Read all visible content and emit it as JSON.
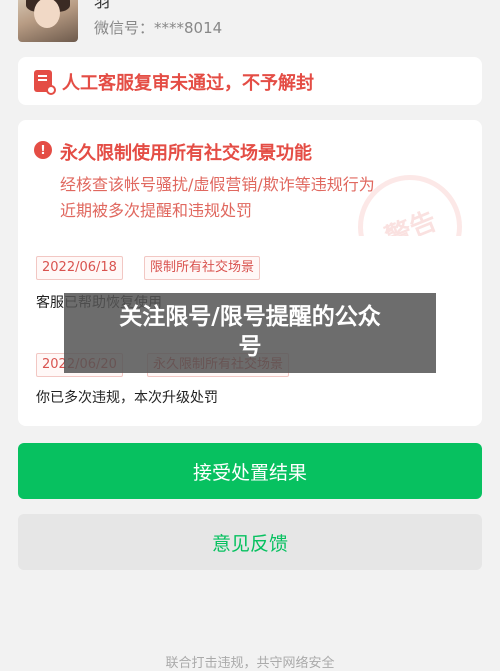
{
  "profile": {
    "nickname": "羽",
    "wechat_id": "微信号：****8014"
  },
  "status": {
    "icon": "no-entry-document-icon",
    "title": "人工客服复审未通过，不予解封"
  },
  "restriction": {
    "icon": "exclamation-circle-icon",
    "title": "永久限制使用所有社交场景功能",
    "desc_line1": "经核查该帐号骚扰/虚假营销/欺诈等违规行为",
    "desc_line2": "近期被多次提醒和违规处罚",
    "seal_text": "警告"
  },
  "timeline": [
    {
      "date": "2022/06/18",
      "tag": "限制所有社交场景",
      "text": "客服已帮助恢复使用"
    },
    {
      "date": "2022/06/20",
      "tag": "永久限制所有社交场景",
      "text": "你已多次违规，本次升级处罚"
    }
  ],
  "overlay": {
    "line1": "关注限号/限号提醒的公众",
    "line2": "号"
  },
  "buttons": {
    "accept": "接受处置结果",
    "feedback": "意见反馈"
  },
  "footer": "联合打击违规，共守网络安全",
  "colors": {
    "brand_green": "#07c160",
    "alert_red": "#e44d45",
    "page_bg": "#f2f2f2"
  }
}
